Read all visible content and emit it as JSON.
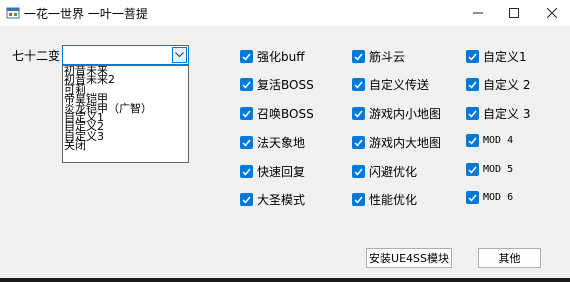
{
  "window": {
    "title": "一花一世界 一叶一菩提"
  },
  "combo": {
    "label": "七十二变",
    "value": "",
    "options": [
      "初音未来",
      "初音未来2",
      "可莉",
      "帝皇铠甲",
      "炎龙铠甲（广智）",
      "自定义1",
      "自定义2",
      "自定义3",
      "关闭"
    ]
  },
  "checkboxes": {
    "col1": [
      "强化buff",
      "复活BOSS",
      "召唤BOSS",
      "法天象地",
      "快速回复",
      "大圣模式"
    ],
    "col2": [
      "筋斗云",
      "自定义传送",
      "游戏内小地图",
      "游戏内大地图",
      "闪避优化",
      "性能优化"
    ],
    "col3": [
      "自定义1",
      "自定义 2",
      "自定义 3",
      "MOD 4",
      "MOD 5",
      "MOD 6"
    ]
  },
  "buttons": {
    "install": "安装UE4SS模块",
    "other": "其他"
  },
  "colors": {
    "accent": "#0078d7"
  }
}
